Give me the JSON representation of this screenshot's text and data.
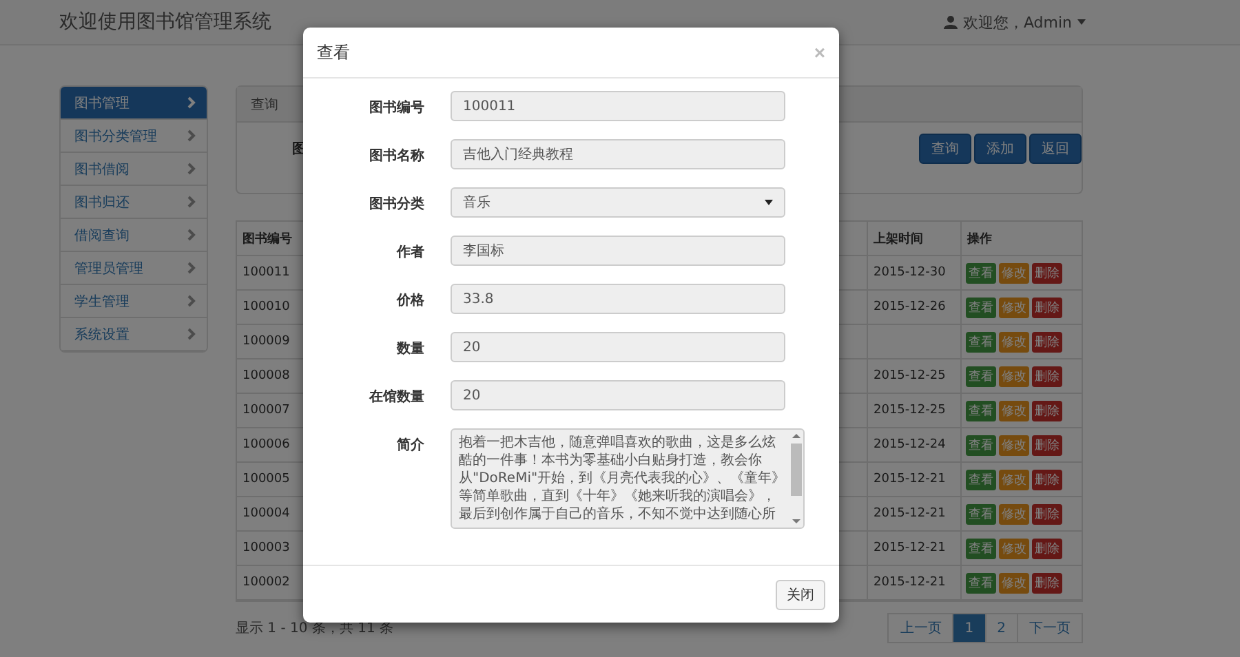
{
  "header": {
    "title": "欢迎使用图书馆管理系统",
    "user": "欢迎您，Admin"
  },
  "sidebar": {
    "items": [
      {
        "label": "图书管理",
        "selected": true
      },
      {
        "label": "图书分类管理",
        "selected": false
      },
      {
        "label": "图书借阅",
        "selected": false
      },
      {
        "label": "图书归还",
        "selected": false
      },
      {
        "label": "借阅查询",
        "selected": false
      },
      {
        "label": "管理员管理",
        "selected": false
      },
      {
        "label": "学生管理",
        "selected": false
      },
      {
        "label": "系统设置",
        "selected": false
      }
    ]
  },
  "search_panel": {
    "title": "查询",
    "label": "图",
    "buttons": [
      "查询",
      "添加",
      "返回"
    ]
  },
  "table": {
    "columns": [
      "图书编号",
      "上架时间",
      "操作"
    ],
    "rows": [
      {
        "id": "100011",
        "date": "2015-12-30",
        "actions": [
          {
            "label": "查看",
            "kind": "view"
          },
          {
            "label": "修改",
            "kind": "edit"
          },
          {
            "label": "删除",
            "kind": "delete"
          }
        ]
      },
      {
        "id": "100010",
        "date": "2015-12-26",
        "actions": [
          {
            "label": "查看",
            "kind": "view"
          },
          {
            "label": "修改",
            "kind": "edit"
          },
          {
            "label": "删除",
            "kind": "delete"
          }
        ]
      },
      {
        "id": "100009",
        "actions": [
          {
            "label": "查看",
            "kind": "view"
          },
          {
            "label": "修改",
            "kind": "edit"
          },
          {
            "label": "删除",
            "kind": "delete"
          }
        ]
      },
      {
        "id": "100008",
        "date": "2015-12-25",
        "actions": [
          {
            "label": "查看",
            "kind": "view"
          },
          {
            "label": "修改",
            "kind": "edit"
          },
          {
            "label": "删除",
            "kind": "delete"
          }
        ]
      },
      {
        "id": "100007",
        "date": "2015-12-25",
        "actions": [
          {
            "label": "查看",
            "kind": "view"
          },
          {
            "label": "修改",
            "kind": "edit"
          },
          {
            "label": "删除",
            "kind": "delete"
          }
        ]
      },
      {
        "id": "100006",
        "date": "2015-12-24",
        "actions": [
          {
            "label": "查看",
            "kind": "view"
          },
          {
            "label": "修改",
            "kind": "edit"
          },
          {
            "label": "删除",
            "kind": "delete"
          }
        ]
      },
      {
        "id": "100005",
        "date": "2015-12-21",
        "actions": [
          {
            "label": "查看",
            "kind": "view"
          },
          {
            "label": "修改",
            "kind": "edit"
          },
          {
            "label": "删除",
            "kind": "delete"
          }
        ]
      },
      {
        "id": "100004",
        "date": "2015-12-21",
        "actions": [
          {
            "label": "查看",
            "kind": "view"
          },
          {
            "label": "修改",
            "kind": "edit"
          },
          {
            "label": "删除",
            "kind": "delete"
          }
        ]
      },
      {
        "id": "100003",
        "date": "2015-12-21",
        "actions": [
          {
            "label": "查看",
            "kind": "view"
          },
          {
            "label": "修改",
            "kind": "edit"
          },
          {
            "label": "删除",
            "kind": "delete"
          }
        ]
      },
      {
        "id": "100002",
        "date": "2015-12-21",
        "actions": [
          {
            "label": "查看",
            "kind": "view"
          },
          {
            "label": "修改",
            "kind": "edit"
          },
          {
            "label": "删除",
            "kind": "delete"
          }
        ]
      }
    ]
  },
  "summary": "显示 1 - 10 条，共 11 条",
  "pagination": [
    {
      "label": "上一页",
      "selected": false
    },
    {
      "label": "1",
      "selected": true
    },
    {
      "label": "2",
      "selected": false
    },
    {
      "label": "下一页",
      "selected": false
    }
  ],
  "modal": {
    "title": "查看",
    "close": "×",
    "fields": [
      {
        "label": "图书编号",
        "value": "100011",
        "kind": "input"
      },
      {
        "label": "图书名称",
        "value": "吉他入门经典教程",
        "kind": "input"
      },
      {
        "label": "图书分类",
        "value": "音乐",
        "kind": "select"
      },
      {
        "label": "作者",
        "value": "李国标",
        "kind": "input"
      },
      {
        "label": "价格",
        "value": "33.8",
        "kind": "input"
      },
      {
        "label": "数量",
        "value": "20",
        "kind": "input"
      },
      {
        "label": "在馆数量",
        "value": "20",
        "kind": "input"
      },
      {
        "label": "简介",
        "value": "抱着一把木吉他，随意弹唱喜欢的歌曲，这是多么炫酷的一件事！本书为零基础小白贴身打造，教会你从\"DoReMi\"开始，到《月亮代表我的心》、《童年》等简单歌曲，直到《十年》《她来听我的演唱会》，最后到创作属于自己的音乐，不知不觉中达到随心所",
        "kind": "textarea"
      }
    ],
    "button": "关闭"
  }
}
